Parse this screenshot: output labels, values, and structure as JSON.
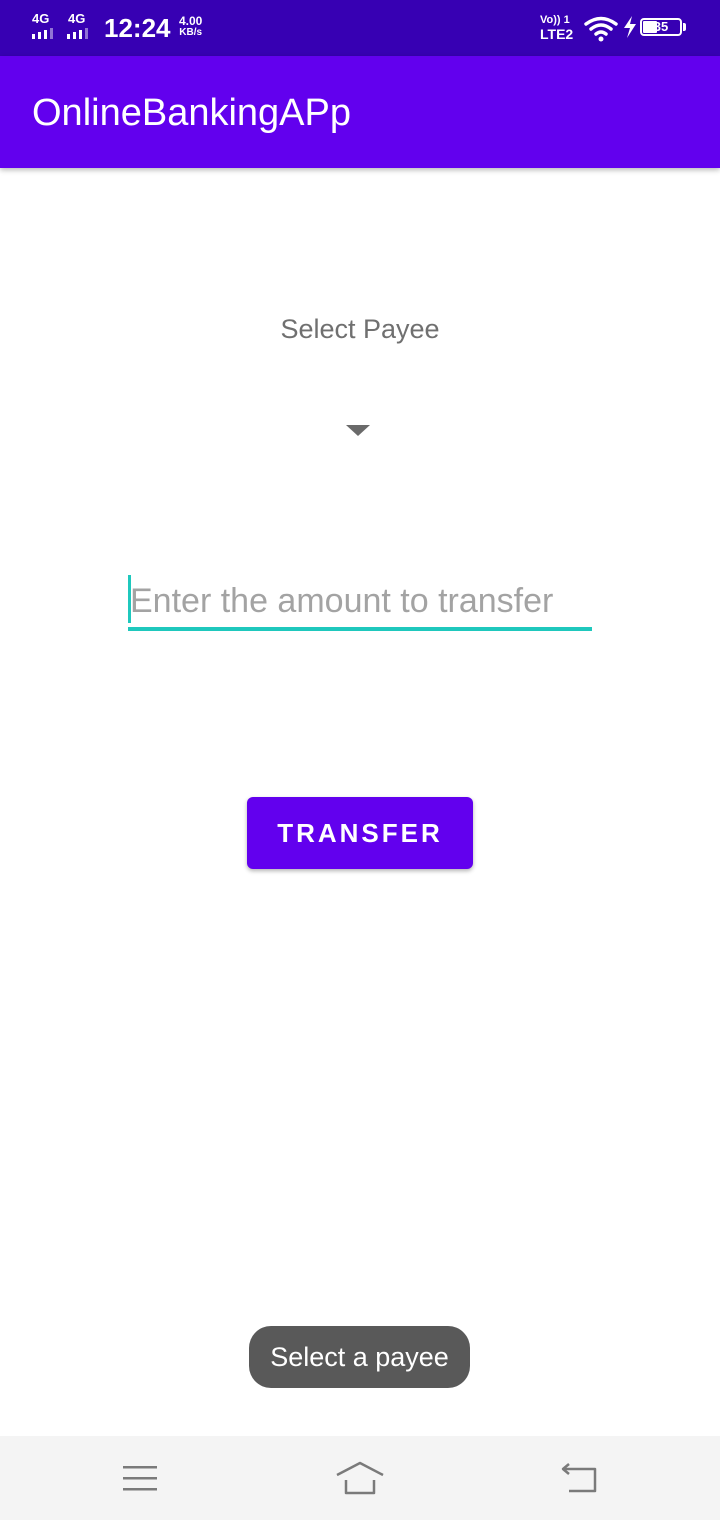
{
  "status_bar": {
    "network_1": "4G",
    "network_2": "4G",
    "time": "12:24",
    "speed_value": "4.00",
    "speed_unit": "KB/s",
    "volte": "Vo)) 1",
    "lte": "LTE2",
    "battery": "35",
    "icons": [
      "signal-icon",
      "wifi-icon",
      "charging-icon",
      "battery-icon"
    ]
  },
  "app_bar": {
    "title": "OnlineBankingAPp"
  },
  "form": {
    "payee_label": "Select Payee",
    "amount_placeholder": "Enter the amount to transfer",
    "amount_value": "",
    "transfer_button": "TRANSFER"
  },
  "toast": {
    "message": "Select a payee"
  },
  "nav_bar": {
    "icons": [
      "menu-icon",
      "home-icon",
      "back-icon"
    ]
  },
  "colors": {
    "status_bar": "#3700b3",
    "primary": "#6200ee",
    "accent": "#1fc8bd",
    "toast_bg": "#595959"
  }
}
